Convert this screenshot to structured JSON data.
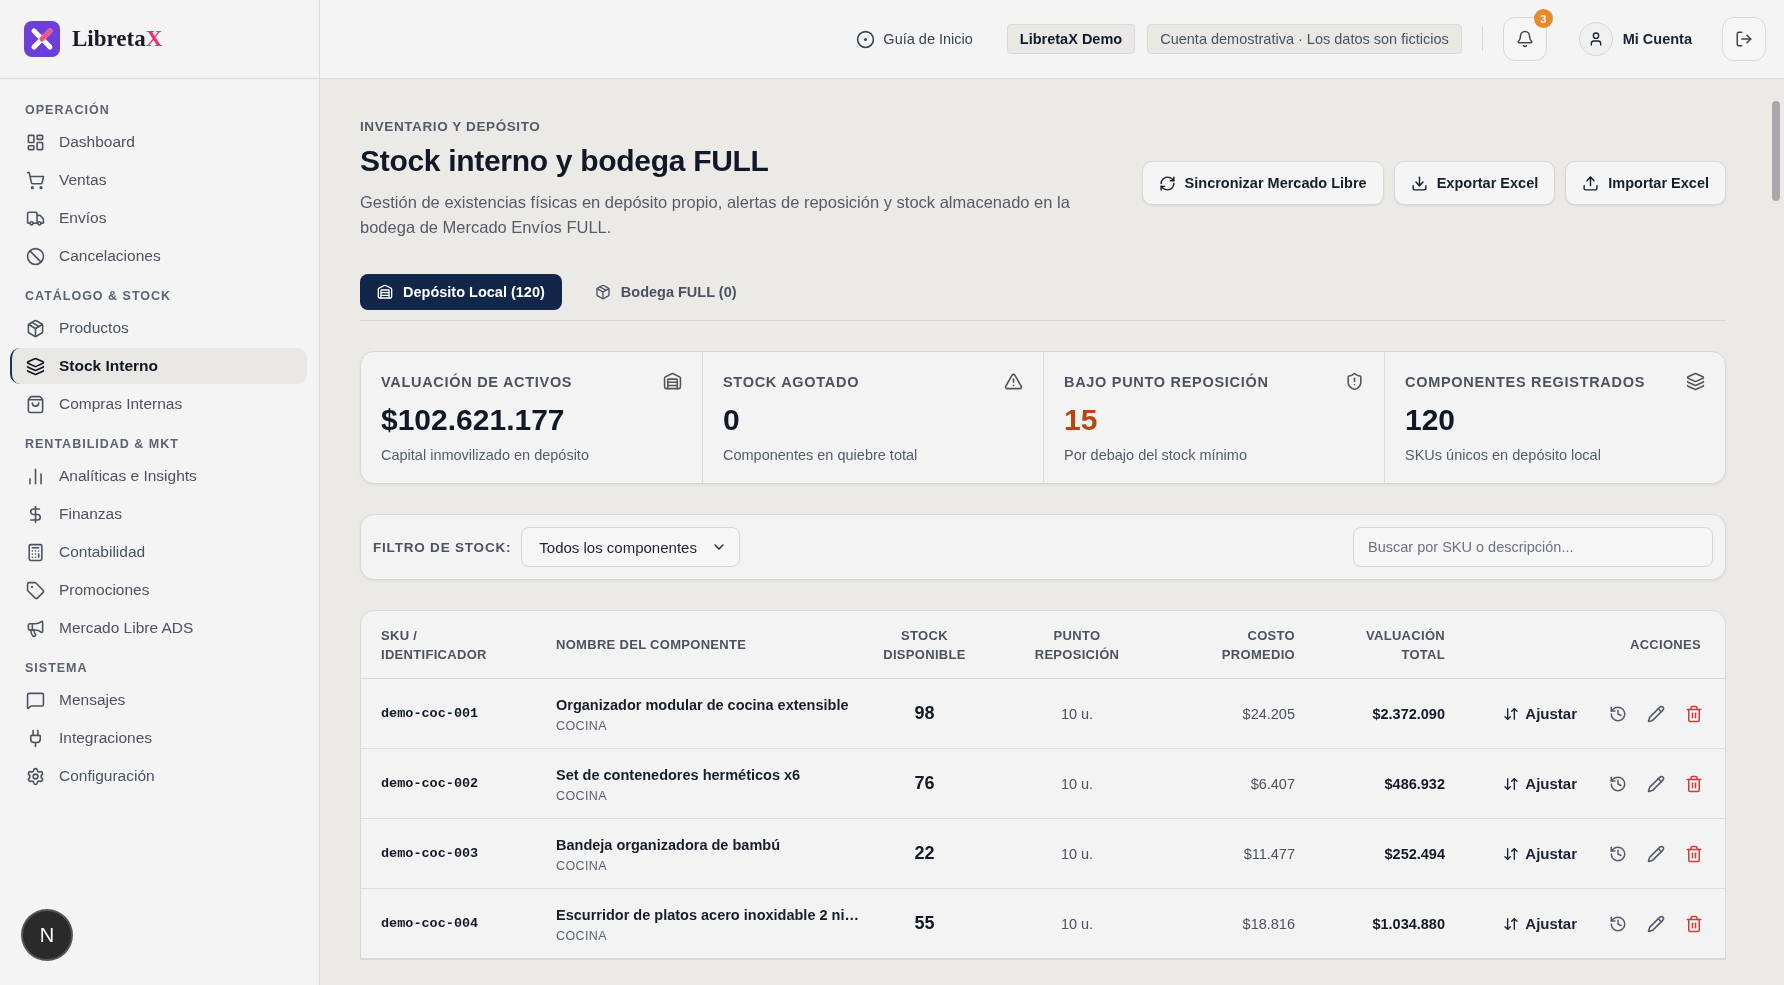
{
  "brand": {
    "name": "Libreta",
    "accent": "X"
  },
  "sidebar": {
    "sections": [
      {
        "title": "OPERACIÓN",
        "items": [
          {
            "label": "Dashboard",
            "selected": false
          },
          {
            "label": "Ventas",
            "selected": false
          },
          {
            "label": "Envíos",
            "selected": false
          },
          {
            "label": "Cancelaciones",
            "selected": false
          }
        ]
      },
      {
        "title": "CATÁLOGO & STOCK",
        "items": [
          {
            "label": "Productos",
            "selected": false
          },
          {
            "label": "Stock Interno",
            "selected": true
          },
          {
            "label": "Compras Internas",
            "selected": false
          }
        ]
      },
      {
        "title": "RENTABILIDAD & MKT",
        "items": [
          {
            "label": "Analíticas e Insights",
            "selected": false
          },
          {
            "label": "Finanzas",
            "selected": false
          },
          {
            "label": "Contabilidad",
            "selected": false
          },
          {
            "label": "Promociones",
            "selected": false
          },
          {
            "label": "Mercado Libre ADS",
            "selected": false
          }
        ]
      },
      {
        "title": "SISTEMA",
        "items": [
          {
            "label": "Mensajes",
            "selected": false
          },
          {
            "label": "Integraciones",
            "selected": false
          },
          {
            "label": "Configuración",
            "selected": false
          }
        ]
      }
    ],
    "dev_badge": "N"
  },
  "header": {
    "guide": "Guía de Inicio",
    "demo_chip": "LibretaX Demo",
    "notice": "Cuenta demostrativa · Los datos son ficticios",
    "notifications": "3",
    "account": "Mi Cuenta"
  },
  "page": {
    "kicker": "INVENTARIO Y DEPÓSITO",
    "title": "Stock interno y bodega FULL",
    "description": "Gestión de existencias físicas en depósito propio, alertas de reposición y stock almacenado en la bodega de Mercado Envíos FULL.",
    "actions": [
      "Sincronizar Mercado Libre",
      "Exportar Excel",
      "Importar Excel"
    ]
  },
  "tabs": [
    {
      "label": "Depósito Local (120)",
      "selected": true
    },
    {
      "label": "Bodega FULL (0)",
      "selected": false
    }
  ],
  "cards": [
    {
      "title": "VALUACIÓN DE ACTIVOS",
      "value": "$102.621.177",
      "caption": "Capital inmovilizado en depósito",
      "warning": false
    },
    {
      "title": "STOCK AGOTADO",
      "value": "0",
      "caption": "Componentes en quiebre total",
      "warning": false
    },
    {
      "title": "BAJO PUNTO REPOSICIÓN",
      "value": "15",
      "caption": "Por debajo del stock mínimo",
      "warning": true
    },
    {
      "title": "COMPONENTES REGISTRADOS",
      "value": "120",
      "caption": "SKUs únicos en depósito local",
      "warning": false
    }
  ],
  "filter": {
    "label": "FILTRO DE STOCK:",
    "value": "Todos los componentes",
    "search_placeholder": "Buscar por SKU o descripción..."
  },
  "table": {
    "columns": [
      "SKU / IDENTIFICADOR",
      "NOMBRE DEL COMPONENTE",
      "STOCK DISPONIBLE",
      "PUNTO REPOSICIÓN",
      "COSTO PROMEDIO",
      "VALUACIÓN TOTAL",
      "ACCIONES"
    ],
    "rows": [
      {
        "sku": "demo-coc-001",
        "name": "Organizador modular de cocina extensible",
        "category": "COCINA",
        "stock": "98",
        "reorder": "10 u.",
        "cost": "$24.205",
        "valuation": "$2.372.090",
        "action": "Ajustar"
      },
      {
        "sku": "demo-coc-002",
        "name": "Set de contenedores herméticos x6",
        "category": "COCINA",
        "stock": "76",
        "reorder": "10 u.",
        "cost": "$6.407",
        "valuation": "$486.932",
        "action": "Ajustar"
      },
      {
        "sku": "demo-coc-003",
        "name": "Bandeja organizadora de bambú",
        "category": "COCINA",
        "stock": "22",
        "reorder": "10 u.",
        "cost": "$11.477",
        "valuation": "$252.494",
        "action": "Ajustar"
      },
      {
        "sku": "demo-coc-004",
        "name": "Escurridor de platos acero inoxidable 2 ni…",
        "category": "COCINA",
        "stock": "55",
        "reorder": "10 u.",
        "cost": "$18.816",
        "valuation": "$1.034.880",
        "action": "Ajustar"
      }
    ]
  }
}
